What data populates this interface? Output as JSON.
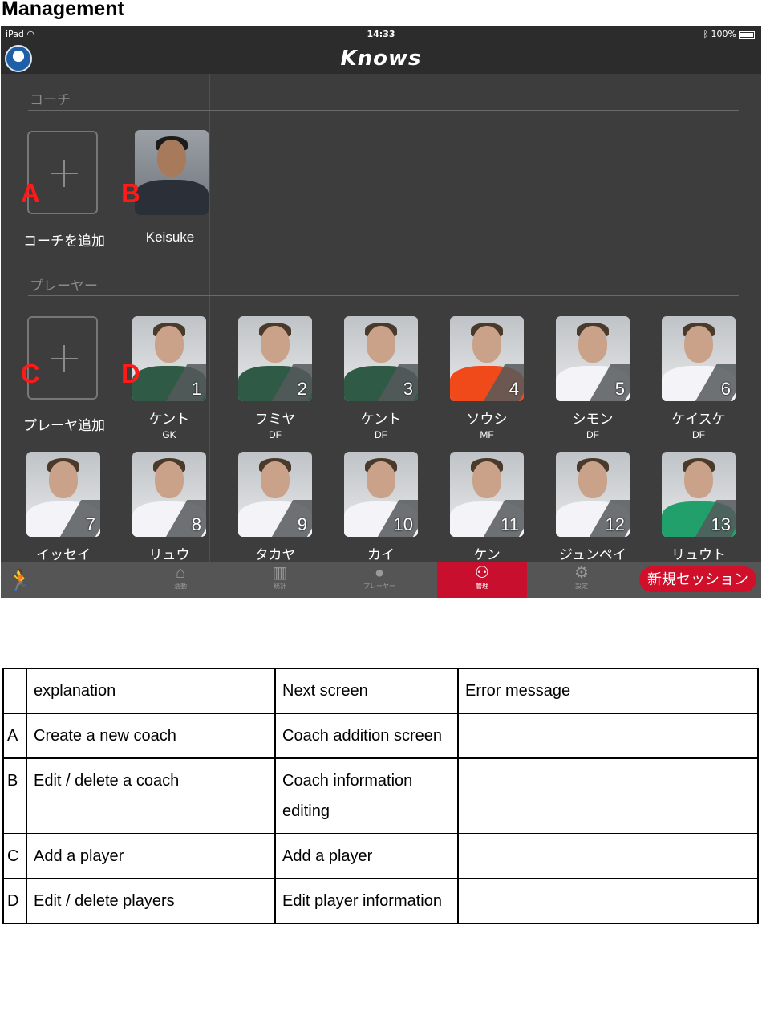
{
  "page": {
    "heading": "Management"
  },
  "statusbar": {
    "device": "iPad",
    "wifi": "wifi-icon",
    "time": "14:33",
    "bluetooth": "bluetooth-icon",
    "battery": "100%"
  },
  "navbar": {
    "brand": "Knows"
  },
  "coach_section": {
    "title": "コーチ",
    "add_label": "コーチを追加",
    "coaches": [
      {
        "name": "Keisuke"
      }
    ]
  },
  "player_section": {
    "title": "プレーヤー",
    "add_label": "プレーヤ追加",
    "players": [
      {
        "number": "1",
        "name": "ケント",
        "position": "GK",
        "shirt": "#2f5a45"
      },
      {
        "number": "2",
        "name": "フミヤ",
        "position": "DF",
        "shirt": "#2f5a45"
      },
      {
        "number": "3",
        "name": "ケント",
        "position": "DF",
        "shirt": "#2f5a45"
      },
      {
        "number": "4",
        "name": "ソウシ",
        "position": "MF",
        "shirt": "#f04a1a"
      },
      {
        "number": "5",
        "name": "シモン",
        "position": "DF",
        "shirt": "#f3f3f8"
      },
      {
        "number": "6",
        "name": "ケイスケ",
        "position": "DF",
        "shirt": "#f3f3f8"
      },
      {
        "number": "7",
        "name": "イッセイ",
        "position": "",
        "shirt": "#f3f3f8"
      },
      {
        "number": "8",
        "name": "リュウ",
        "position": "",
        "shirt": "#f3f3f8"
      },
      {
        "number": "9",
        "name": "タカヤ",
        "position": "",
        "shirt": "#f3f3f8"
      },
      {
        "number": "10",
        "name": "カイ",
        "position": "",
        "shirt": "#f3f3f8"
      },
      {
        "number": "11",
        "name": "ケン",
        "position": "",
        "shirt": "#f3f3f8"
      },
      {
        "number": "12",
        "name": "ジュンペイ",
        "position": "",
        "shirt": "#f3f3f8"
      },
      {
        "number": "13",
        "name": "リュウト",
        "position": "",
        "shirt": "#22a06b"
      }
    ]
  },
  "tabbar": {
    "tabs": [
      {
        "label": "活動",
        "icon": "building-icon"
      },
      {
        "label": "統計",
        "icon": "bar-chart-icon"
      },
      {
        "label": "プレーヤー",
        "icon": "person-icon"
      },
      {
        "label": "管理",
        "icon": "people-icon",
        "active": true
      },
      {
        "label": "設定",
        "icon": "gear-icon"
      }
    ],
    "new_session": "新規セッション"
  },
  "markers": [
    "A",
    "B",
    "C",
    "D"
  ],
  "colors": {
    "accent_red": "#c8102e",
    "marker_red": "#ff1a1a",
    "app_bg": "#3d3d3d"
  },
  "table": {
    "headers": [
      "",
      "explanation",
      "Next screen",
      "Error message"
    ],
    "rows": [
      {
        "key": "A",
        "explanation": "Create a new coach",
        "next": "Coach addition screen",
        "error": ""
      },
      {
        "key": "B",
        "explanation": "Edit / delete a coach",
        "next": "Coach information editing",
        "error": ""
      },
      {
        "key": "C",
        "explanation": "Add a player",
        "next": "Add a player",
        "error": ""
      },
      {
        "key": "D",
        "explanation": "Edit / delete players",
        "next": "Edit player information",
        "error": ""
      }
    ]
  }
}
